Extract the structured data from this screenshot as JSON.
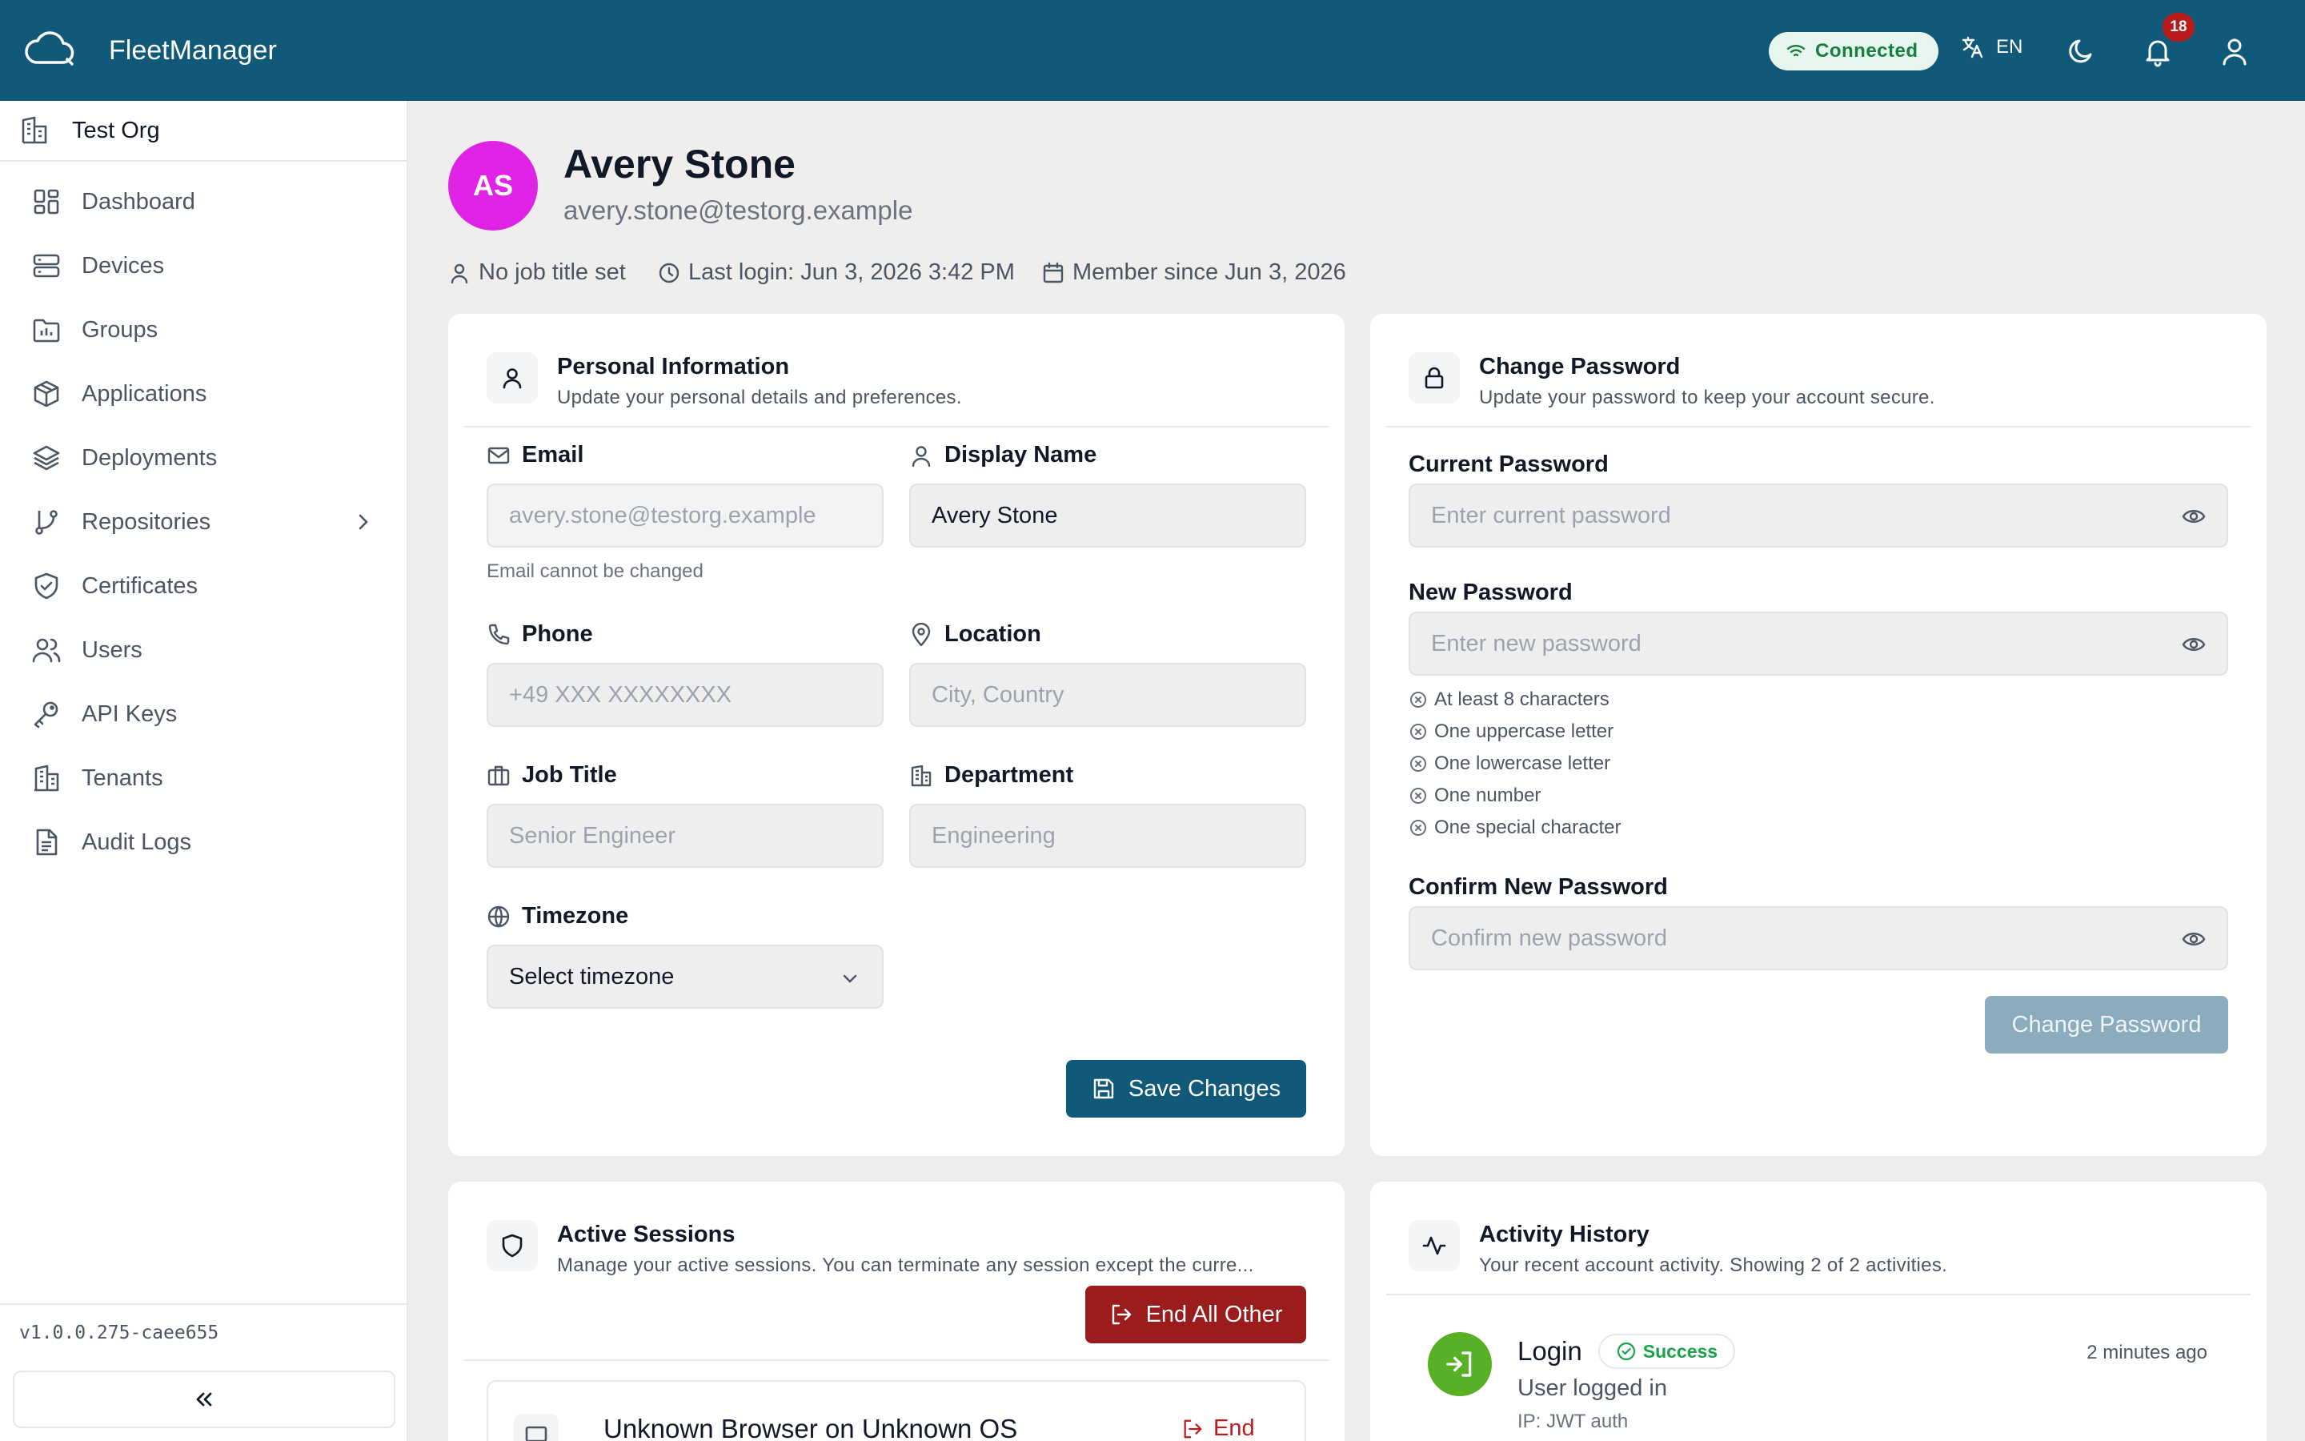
{
  "header": {
    "app_title": "FleetManager",
    "connection_status": "Connected",
    "language": "EN",
    "notification_count": "18"
  },
  "sidebar": {
    "org_name": "Test Org",
    "items": [
      {
        "label": "Dashboard",
        "icon": "dashboard-icon"
      },
      {
        "label": "Devices",
        "icon": "server-icon"
      },
      {
        "label": "Groups",
        "icon": "folder-icon"
      },
      {
        "label": "Applications",
        "icon": "package-icon"
      },
      {
        "label": "Deployments",
        "icon": "layers-icon"
      },
      {
        "label": "Repositories",
        "icon": "git-branch-icon"
      },
      {
        "label": "Certificates",
        "icon": "shield-check-icon"
      },
      {
        "label": "Users",
        "icon": "users-icon"
      },
      {
        "label": "API Keys",
        "icon": "key-icon"
      },
      {
        "label": "Tenants",
        "icon": "building-icon"
      },
      {
        "label": "Audit Logs",
        "icon": "file-text-icon"
      }
    ],
    "version": "v1.0.0.275-caee655",
    "collapse_label": "«"
  },
  "profile": {
    "initials": "AS",
    "name": "Avery Stone",
    "email": "avery.stone@testorg.example",
    "job_title": "No job title set",
    "last_login": "Last login: Jun 3, 2026 3:42 PM",
    "member_since": "Member since Jun 3, 2026"
  },
  "personal_info": {
    "title": "Personal Information",
    "subtitle": "Update your personal details and preferences.",
    "email_label": "Email",
    "email_value": "avery.stone@testorg.example",
    "email_hint": "Email cannot be changed",
    "display_name_label": "Display Name",
    "display_name_value": "Avery Stone",
    "phone_label": "Phone",
    "phone_placeholder": "+49 XXX XXXXXXXX",
    "location_label": "Location",
    "location_placeholder": "City, Country",
    "job_title_label": "Job Title",
    "job_title_placeholder": "Senior Engineer",
    "department_label": "Department",
    "department_placeholder": "Engineering",
    "timezone_label": "Timezone",
    "timezone_value": "Select timezone",
    "save_label": "Save Changes"
  },
  "change_password": {
    "title": "Change Password",
    "subtitle": "Update your password to keep your account secure.",
    "current_label": "Current Password",
    "current_placeholder": "Enter current password",
    "new_label": "New Password",
    "new_placeholder": "Enter new password",
    "requirements": [
      "At least 8 characters",
      "One uppercase letter",
      "One lowercase letter",
      "One number",
      "One special character"
    ],
    "confirm_label": "Confirm New Password",
    "confirm_placeholder": "Confirm new password",
    "submit_label": "Change Password"
  },
  "sessions": {
    "title": "Active Sessions",
    "subtitle": "Manage your active sessions. You can terminate any session except the curre...",
    "end_all_label": "End All Other",
    "session_name": "Unknown Browser on Unknown OS",
    "end_label": "End"
  },
  "activity": {
    "title": "Activity History",
    "subtitle": "Your recent account activity. Showing 2 of 2 activities.",
    "item_title": "Login",
    "item_status": "Success",
    "item_desc": "User logged in",
    "item_ip": "IP: JWT auth",
    "item_time": "2 minutes ago"
  },
  "colors": {
    "brand": "#115978",
    "avatar": "#e024e6",
    "danger": "#9b1c1c",
    "success": "#16a34a"
  }
}
